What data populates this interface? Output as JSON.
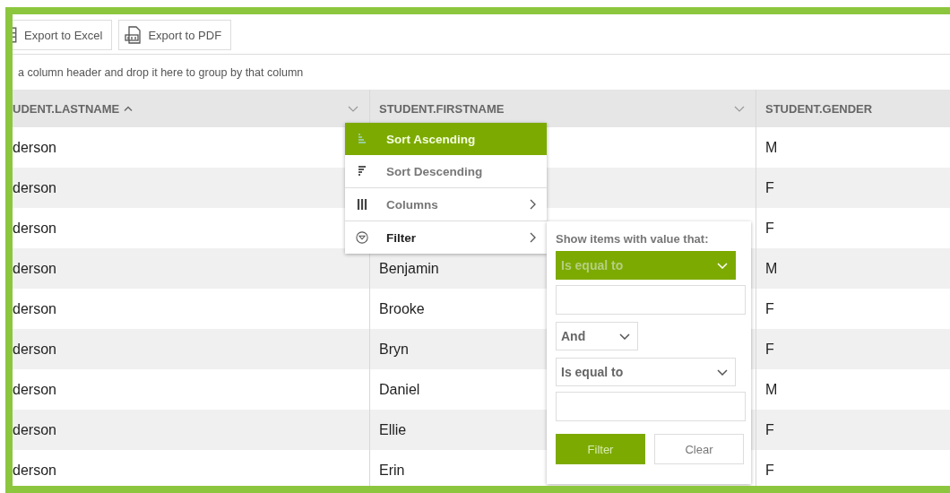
{
  "toolbar": {
    "buttons": [
      {
        "label": "Export to Excel",
        "kind": "excel"
      },
      {
        "label": "Export to PDF",
        "kind": "pdf"
      }
    ]
  },
  "group_hint": "a column header and drop it here to group by that column",
  "table": {
    "columns": [
      {
        "label": "UDENT.LASTNAME",
        "sorted_ascending": true,
        "menu": true
      },
      {
        "label": "STUDENT.FIRSTNAME",
        "sorted_ascending": false,
        "menu": true
      },
      {
        "label": "STUDENT.GENDER",
        "sorted_ascending": false,
        "menu": false
      }
    ],
    "rows": [
      [
        "derson",
        "",
        "M"
      ],
      [
        "derson",
        "",
        "F"
      ],
      [
        "derson",
        "",
        "F"
      ],
      [
        "derson",
        "Benjamin",
        "M"
      ],
      [
        "derson",
        "Brooke",
        "F"
      ],
      [
        "derson",
        "Bryn",
        "F"
      ],
      [
        "derson",
        "Daniel",
        "M"
      ],
      [
        "derson",
        "Ellie",
        "F"
      ],
      [
        "derson",
        "Erin",
        "F"
      ]
    ]
  },
  "column_menu": {
    "items": [
      {
        "label": "Sort Ascending",
        "kind": "sort-asc",
        "selected": true,
        "expanded": false,
        "submenu": false
      },
      {
        "label": "Sort Descending",
        "kind": "sort-desc",
        "selected": false,
        "expanded": false,
        "submenu": false
      },
      {
        "label": "Columns",
        "kind": "columns",
        "selected": false,
        "expanded": false,
        "submenu": true
      },
      {
        "label": "Filter",
        "kind": "filter",
        "selected": false,
        "expanded": true,
        "submenu": true
      }
    ]
  },
  "filter_popup": {
    "prompt": "Show items with value that:",
    "controls": [
      {
        "kind": "select",
        "value": "Is equal to",
        "highlighted": true
      },
      {
        "kind": "input"
      },
      {
        "kind": "logic",
        "value": "And",
        "highlighted": false
      },
      {
        "kind": "select",
        "value": "Is equal to",
        "highlighted": false
      },
      {
        "kind": "input"
      }
    ],
    "buttons": [
      {
        "label": "Filter",
        "primary": true
      },
      {
        "label": "Clear",
        "primary": false
      }
    ]
  }
}
